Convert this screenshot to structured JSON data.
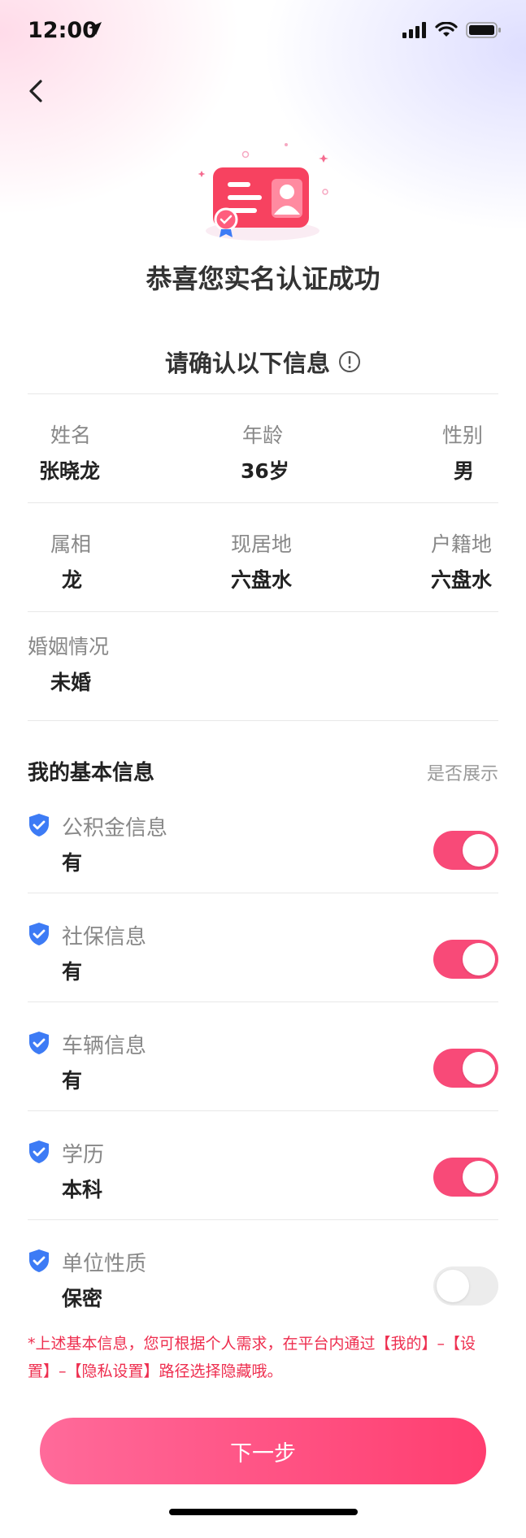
{
  "status_bar": {
    "time": "12:00"
  },
  "header": {
    "success_title": "恭喜您实名认证成功",
    "confirm_title": "请确认以下信息"
  },
  "identity": {
    "name_label": "姓名",
    "name_value": "张晓龙",
    "age_label": "年龄",
    "age_value": "36岁",
    "gender_label": "性别",
    "gender_value": "男",
    "zodiac_label": "属相",
    "zodiac_value": "龙",
    "residence_label": "现居地",
    "residence_value": "六盘水",
    "hukou_label": "户籍地",
    "hukou_value": "六盘水",
    "marital_label": "婚姻情况",
    "marital_value": "未婚"
  },
  "basic_info": {
    "title": "我的基本信息",
    "hint": "是否展示",
    "items": [
      {
        "label": "公积金信息",
        "value": "有",
        "shown": true
      },
      {
        "label": "社保信息",
        "value": "有",
        "shown": true
      },
      {
        "label": "车辆信息",
        "value": "有",
        "shown": true
      },
      {
        "label": "学历",
        "value": "本科",
        "shown": true
      },
      {
        "label": "单位性质",
        "value": "保密",
        "shown": false
      }
    ]
  },
  "note": "*上述基本信息，您可根据个人需求，在平台内通过【我的】–【设置】–【隐私设置】路径选择隐藏哦。",
  "next_button": "下一步",
  "colors": {
    "accent": "#f84a78",
    "note": "#ee2e4f",
    "shield": "#3d7bf5"
  }
}
